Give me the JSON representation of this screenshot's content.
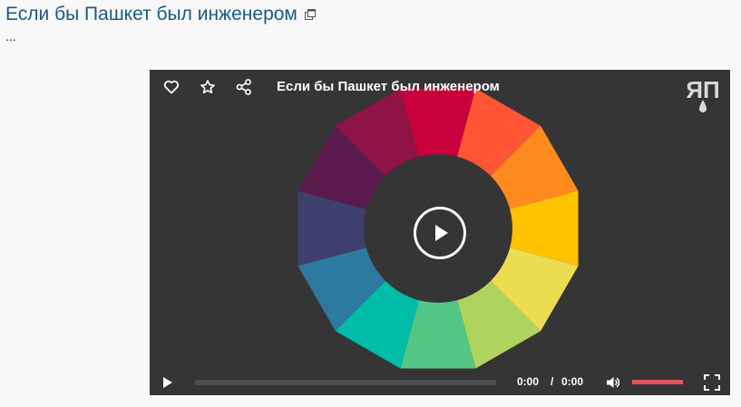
{
  "post": {
    "title": "Если бы Пашкет был инженером",
    "excerpt": "..."
  },
  "player": {
    "video_title": "Если бы Пашкет был инженером",
    "logo_text": "ЯП",
    "time": {
      "current": "0:00",
      "separator": "/",
      "duration": "0:00"
    },
    "progress": 0.0,
    "volume": 1.0,
    "colors": {
      "accent": "#e5525a",
      "background": "#353535",
      "title_link": "#1a5a86"
    },
    "icons": {
      "like": "heart-icon",
      "favorite": "star-icon",
      "share": "share-icon",
      "play": "play-icon",
      "volume": "volume-icon",
      "fullscreen": "fullscreen-icon",
      "external": "external-link-icon"
    },
    "wheel_colors": [
      "#c8003c",
      "#ff5535",
      "#ff8a1e",
      "#ffc200",
      "#ecdc52",
      "#aed35e",
      "#52c785",
      "#00bca8",
      "#2d7aa0",
      "#3f3f6e",
      "#5a1a4e",
      "#8f1344"
    ]
  }
}
